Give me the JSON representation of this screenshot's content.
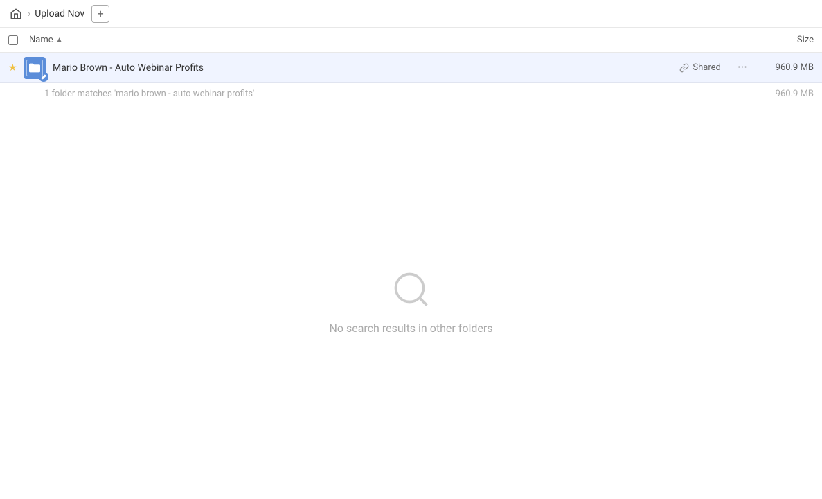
{
  "breadcrumb": {
    "home_icon": "🏠",
    "separator": "›",
    "item": "Upload Nov",
    "add_label": "+"
  },
  "columns": {
    "name_label": "Name",
    "sort_arrow": "▲",
    "size_label": "Size"
  },
  "file_row": {
    "star": "★",
    "name": "Mario Brown - Auto Webinar Profits",
    "shared_label": "Shared",
    "link_icon": "🔗",
    "more_icon": "···",
    "size": "960.9 MB"
  },
  "match_row": {
    "text": "1 folder matches 'mario brown - auto webinar profits'",
    "size": "960.9 MB"
  },
  "empty_state": {
    "message": "No search results in other folders"
  },
  "colors": {
    "folder_blue": "#5b8dd9",
    "header_bg": "#f0f4ff",
    "star_gold": "#f0c040"
  }
}
